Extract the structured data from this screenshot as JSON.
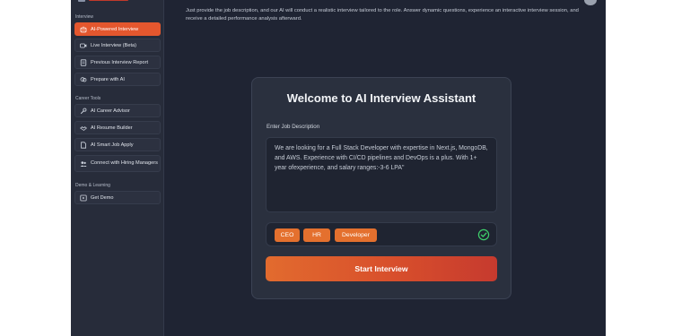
{
  "sidebar": {
    "sections": [
      {
        "title": "Interview",
        "items": [
          {
            "label": "AI-Powered Interview",
            "icon": "ai-robot-icon",
            "active": true
          },
          {
            "label": "Live Interview (Beta)",
            "icon": "video-icon"
          },
          {
            "label": "Previous Interview Report",
            "icon": "report-icon"
          },
          {
            "label": "Prepare with AI",
            "icon": "brain-icon"
          }
        ]
      },
      {
        "title": "Career Tools",
        "items": [
          {
            "label": "AI Career Advisor",
            "icon": "wrench-icon"
          },
          {
            "label": "AI Resume Builder",
            "icon": "handshake-icon"
          },
          {
            "label": "AI Smart Job Apply",
            "icon": "document-icon"
          },
          {
            "label": "Connect with Hiring Managers",
            "icon": "users-icon"
          }
        ]
      },
      {
        "title": "Demo & Learning",
        "items": [
          {
            "label": "Get Demo",
            "icon": "play-icon"
          }
        ]
      }
    ]
  },
  "main": {
    "description": "Just provide the job description, and our AI will conduct a realistic interview tailored to the role. Answer dynamic questions, experience an interactive interview session, and receive a detailed performance analysis afterward."
  },
  "card": {
    "title": "Welcome to AI Interview Assistant",
    "job_label": "Enter Job Description",
    "job_value": "We are looking for a Full Stack Developer with expertise in Next.js, MongoDB, and AWS. Experience with CI/CD pipelines and DevOps is a plus. With 1+ year ofexperience, and salary ranges:-3-6 LPA\"",
    "roles": [
      "CEO",
      "HR",
      "Developer"
    ],
    "start_label": "Start Interview"
  },
  "colors": {
    "accent": "#e4572e",
    "chip": "#e4702e",
    "check": "#3ecf6b",
    "background": "#1f2433",
    "sidebar": "#272c3a"
  }
}
